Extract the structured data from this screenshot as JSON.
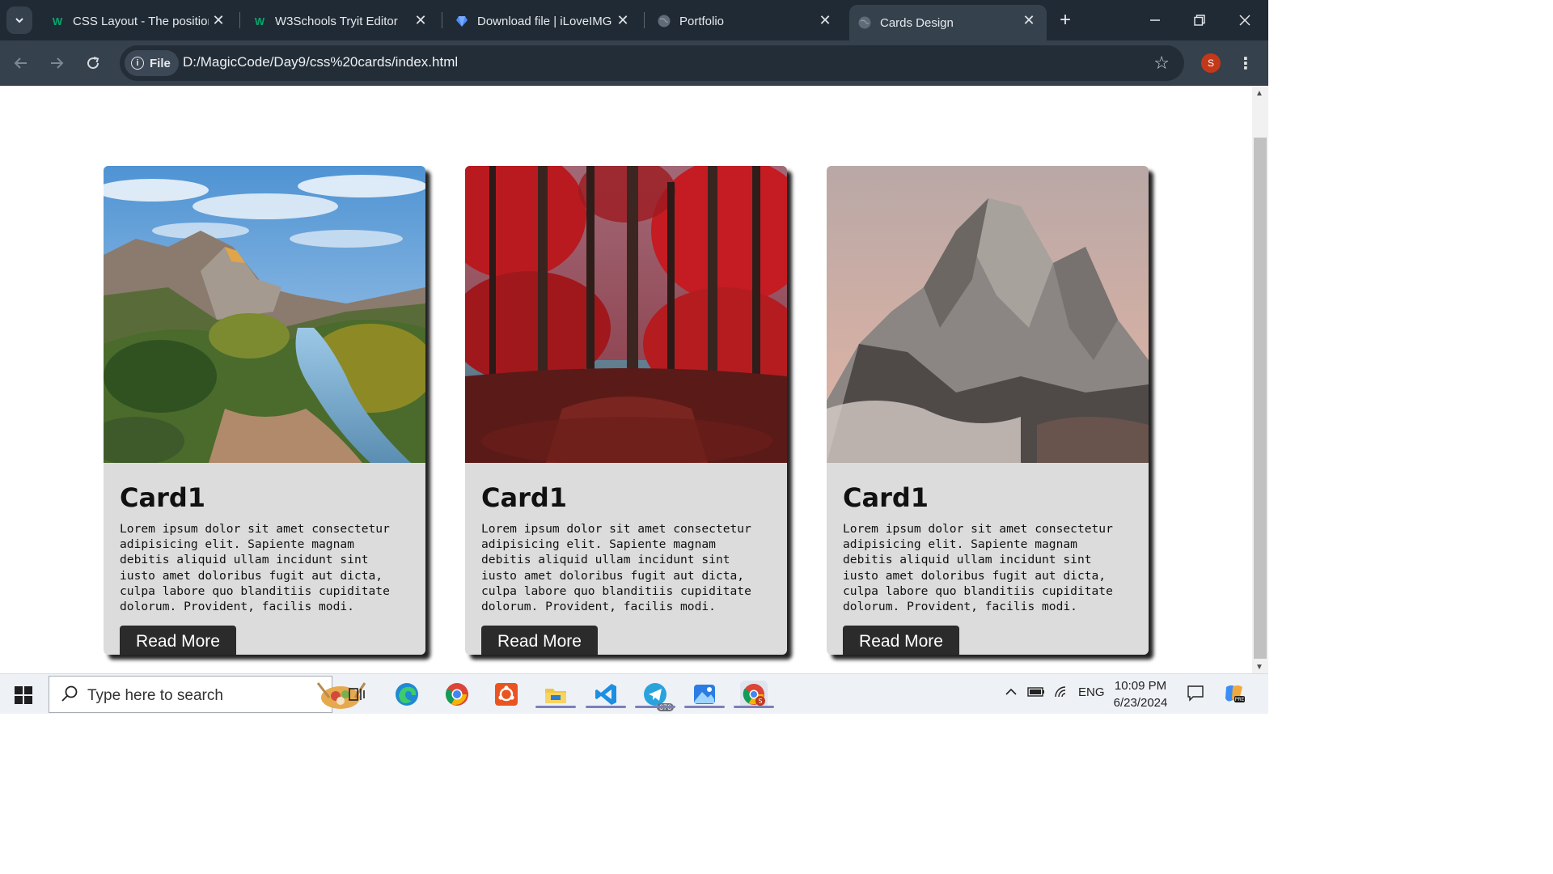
{
  "browser": {
    "tabs": [
      {
        "title": "CSS Layout - The position",
        "favicon": "w3schools-icon",
        "active": false
      },
      {
        "title": "W3Schools Tryit Editor",
        "favicon": "w3schools-icon",
        "active": false
      },
      {
        "title": "Download file | iLoveIMG",
        "favicon": "iloveimg-icon",
        "active": false
      },
      {
        "title": "Portfolio",
        "favicon": "globe-icon",
        "active": false
      },
      {
        "title": "Cards Design",
        "favicon": "globe-icon",
        "active": true
      }
    ],
    "chip_label": "File",
    "url": "D:/MagicCode/Day9/css%20cards/index.html",
    "profile_initial": "S"
  },
  "cards": [
    {
      "title": "Card1",
      "text": "Lorem ipsum dolor sit amet consectetur adipisicing elit. Sapiente magnam debitis aliquid ullam incidunt sint iusto amet doloribus fugit aut dicta, culpa labore quo blanditiis cupiditate dolorum. Provident, facilis modi.",
      "button": "Read More",
      "image": "mountain-valley-river"
    },
    {
      "title": "Card1",
      "text": "Lorem ipsum dolor sit amet consectetur adipisicing elit. Sapiente magnam debitis aliquid ullam incidunt sint iusto amet doloribus fugit aut dicta, culpa labore quo blanditiis cupiditate dolorum. Provident, facilis modi.",
      "button": "Read More",
      "image": "red-autumn-forest"
    },
    {
      "title": "Card1",
      "text": "Lorem ipsum dolor sit amet consectetur adipisicing elit. Sapiente magnam debitis aliquid ullam incidunt sint iusto amet doloribus fugit aut dicta, culpa labore quo blanditiis cupiditate dolorum. Provident, facilis modi.",
      "button": "Read More",
      "image": "rocky-mountain-peak"
    }
  ],
  "taskbar": {
    "search_placeholder": "Type here to search",
    "language": "ENG",
    "time": "10:09 PM",
    "date": "6/23/2024",
    "telegram_badge": "676",
    "apps": [
      "task-view-icon",
      "edge-icon",
      "chrome-icon",
      "ubuntu-icon",
      "file-explorer-icon",
      "vscode-icon",
      "telegram-icon",
      "photos-icon",
      "chrome-profile-icon"
    ]
  },
  "colors": {
    "tabbar": "#202a34",
    "toolbar": "#35414d",
    "card_bg": "#dcdcdc",
    "button_bg": "#2b2b2b"
  }
}
